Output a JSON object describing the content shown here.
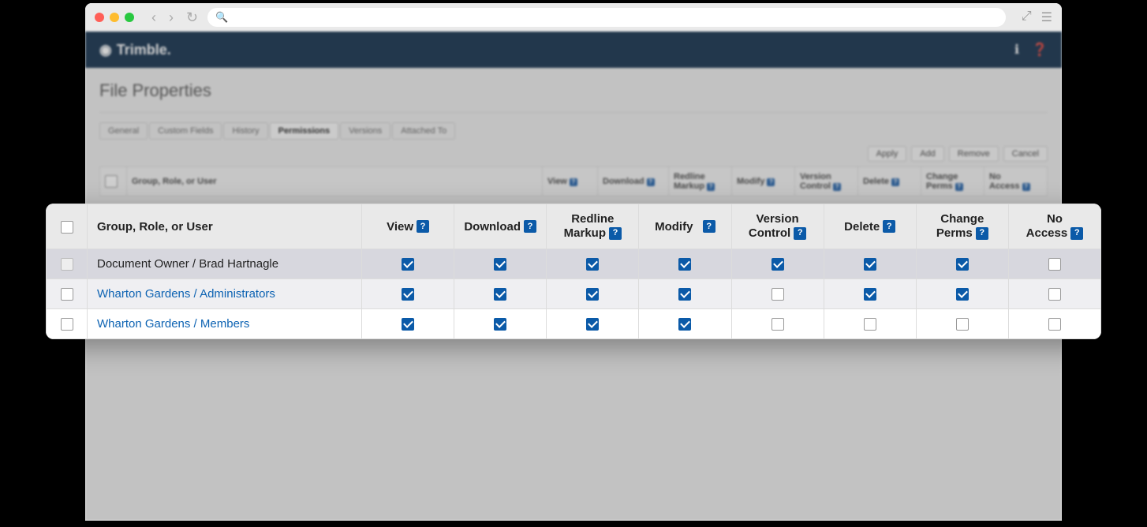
{
  "browser": {
    "search_placeholder": ""
  },
  "header": {
    "brand": "Trimble."
  },
  "page": {
    "title": "File Properties",
    "tabs": [
      "General",
      "Custom Fields",
      "History",
      "Permissions",
      "Versions",
      "Attached To"
    ],
    "active_tab": "Permissions",
    "buttons": {
      "apply": "Apply",
      "add": "Add",
      "remove": "Remove",
      "cancel": "Cancel"
    }
  },
  "columns": {
    "name": "Group, Role, or User",
    "view": "View",
    "download": "Download",
    "redline1": "Redline",
    "redline2": "Markup",
    "modify": "Modify",
    "version1": "Version",
    "version2": "Control",
    "delete": "Delete",
    "change1": "Change",
    "change2": "Perms",
    "no1": "No",
    "no2": "Access"
  },
  "rows": [
    {
      "name": "Document Owner / Brad Hartnagle",
      "link": false,
      "select_disabled": true,
      "perms": {
        "view": true,
        "download": true,
        "redline": true,
        "modify": true,
        "version": true,
        "delete": true,
        "change": true,
        "noaccess": false
      }
    },
    {
      "name": "Wharton Gardens / Administrators",
      "link": true,
      "select_disabled": false,
      "perms": {
        "view": true,
        "download": true,
        "redline": true,
        "modify": true,
        "version": false,
        "delete": true,
        "change": true,
        "noaccess": false
      }
    },
    {
      "name": "Wharton Gardens / Members",
      "link": true,
      "select_disabled": false,
      "perms": {
        "view": true,
        "download": true,
        "redline": true,
        "modify": true,
        "version": false,
        "delete": false,
        "change": false,
        "noaccess": false
      }
    }
  ]
}
